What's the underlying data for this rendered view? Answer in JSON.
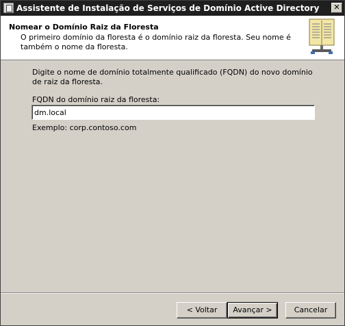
{
  "window": {
    "title": "Assistente de Instalação de Serviços de Domínio Active Directory",
    "close_glyph": "✕"
  },
  "header": {
    "title": "Nomear o Domínio Raiz da Floresta",
    "description": "O primeiro domínio da floresta é o domínio raiz da floresta. Seu nome é também o nome da floresta.",
    "icon": "book-icon"
  },
  "main": {
    "instruction": "Digite o nome de domínio totalmente qualificado (FQDN) do novo domínio de raiz da floresta.",
    "fqdn_label": "FQDN do domínio raiz da floresta:",
    "fqdn_value": "dm.local",
    "example": "Exemplo: corp.contoso.com"
  },
  "buttons": {
    "back": "< Voltar",
    "next": "Avançar >",
    "cancel": "Cancelar"
  }
}
